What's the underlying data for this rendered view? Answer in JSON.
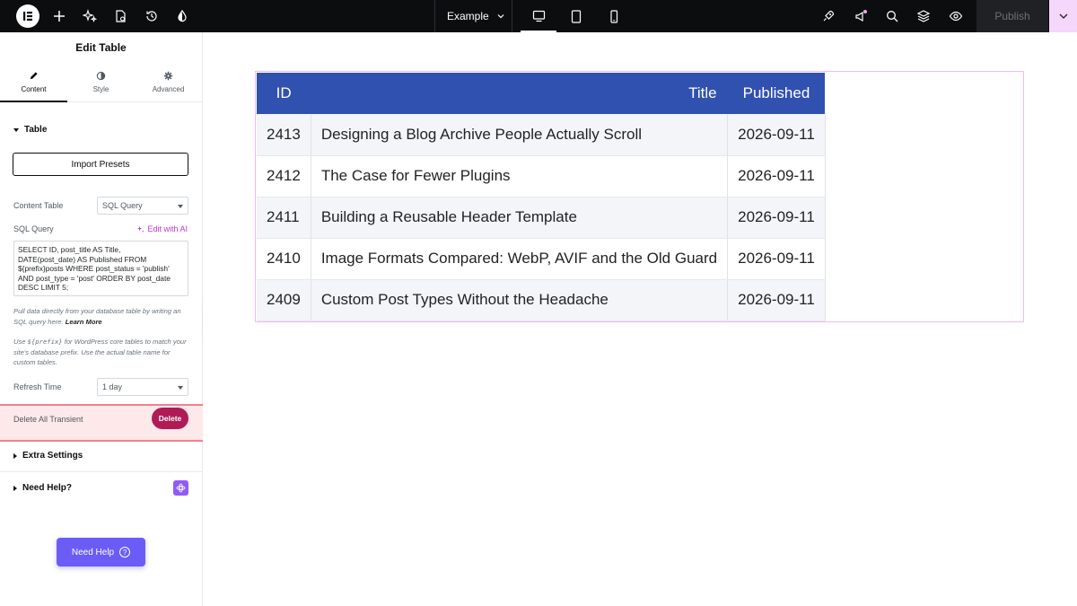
{
  "topbar": {
    "doc_title": "Example",
    "publish_label": "Publish",
    "icons": [
      "elementor-logo-icon",
      "plus-icon",
      "sparkle-icon",
      "page-settings-icon",
      "history-icon",
      "theme-style-icon",
      "rocket-icon",
      "announcement-icon",
      "search-icon",
      "layers-icon",
      "preview-eye-icon"
    ],
    "devices": [
      "desktop-icon",
      "tablet-icon",
      "mobile-icon"
    ]
  },
  "panel": {
    "title": "Edit Table",
    "tabs": [
      {
        "label": "Content",
        "icon": "pencil-icon",
        "active": true
      },
      {
        "label": "Style",
        "icon": "half-circle-icon",
        "active": false
      },
      {
        "label": "Advanced",
        "icon": "gear-icon",
        "active": false
      }
    ],
    "table_section": "Table",
    "import_presets": "Import Presets",
    "content_table_label": "Content Table",
    "content_table_value": "SQL Query",
    "sql_label": "SQL Query",
    "edit_with_ai": "Edit with AI",
    "sql_text": "SELECT ID, post_title AS Title,\nDATE(post_date) AS Published FROM\n${prefix}posts WHERE post_status = 'publish'\nAND post_type = 'post' ORDER BY post_date\nDESC LIMIT 5;",
    "help1": "Pull data directly from your database table by writing an SQL query here.",
    "help1_link": "Learn More",
    "help2_pre": "Use",
    "help2_code": "${prefix}",
    "help2_post": "for WordPress core tables to match your site's database prefix. Use the actual table name for custom tables.",
    "refresh_label": "Refresh Time",
    "refresh_value": "1 day",
    "transient_label": "Delete All Transient",
    "delete_label": "Delete",
    "extra_settings": "Extra Settings",
    "need_help_section": "Need Help?",
    "need_help_button": "Need Help"
  },
  "table": {
    "headers": [
      "ID",
      "Title",
      "Published"
    ],
    "rows": [
      [
        "2413",
        "Designing a Blog Archive People Actually Scroll",
        "2026-09-11"
      ],
      [
        "2412",
        "The Case for Fewer Plugins",
        "2026-09-11"
      ],
      [
        "2411",
        "Building a Reusable Header Template",
        "2026-09-11"
      ],
      [
        "2410",
        "Image Formats Compared: WebP, AVIF and the Old Guard",
        "2026-09-11"
      ],
      [
        "2409",
        "Custom Post Types Without the Headache",
        "2026-09-11"
      ]
    ]
  },
  "colors": {
    "header_bg": "#3151b0",
    "accent_pink": "#c036d6",
    "delete_btn": "#b01b56",
    "help_btn": "#6a5cf5"
  }
}
